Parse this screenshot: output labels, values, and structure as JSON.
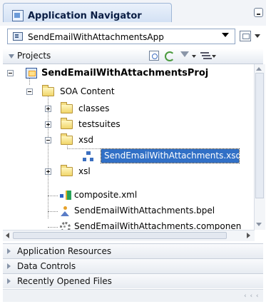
{
  "window": {
    "title": "Application Navigator",
    "title_icon": "application-navigator-icon",
    "minimize_icon": "minimize-icon"
  },
  "app_selector": {
    "value": "SendEmailWithAttachmentsApp",
    "icon": "application-icon"
  },
  "projects_panel": {
    "title": "Projects",
    "toolbar_icons": [
      "refresh-icon",
      "sync-icon",
      "filter-icon",
      "sort-icon"
    ]
  },
  "tree": {
    "project": {
      "label": "SendEmailWithAttachmentsProj",
      "icon": "project-icon"
    },
    "soa_content": {
      "label": "SOA Content",
      "icon": "folder-icon"
    },
    "classes": {
      "label": "classes",
      "icon": "folder-icon"
    },
    "testsuites": {
      "label": "testsuites",
      "icon": "folder-icon"
    },
    "xsd": {
      "label": "xsd",
      "icon": "folder-icon"
    },
    "xsd_file": {
      "label": "SendEmailWithAttachments.xsd",
      "icon": "xsd-schema-icon",
      "selected": true
    },
    "xsl": {
      "label": "xsl",
      "icon": "folder-icon"
    },
    "composite": {
      "label": "composite.xml",
      "icon": "composite-icon"
    },
    "bpel": {
      "label": "SendEmailWithAttachments.bpel",
      "icon": "bpel-process-icon"
    },
    "componentType": {
      "label": "SendEmailWithAttachments.componen",
      "icon": "component-type-icon"
    }
  },
  "accordion": [
    {
      "label": "Application Resources"
    },
    {
      "label": "Data Controls"
    },
    {
      "label": "Recently Opened Files"
    }
  ],
  "colors": {
    "selection": "#3170c6",
    "tab_border": "#9fb6d6",
    "folder_fill": "#f1d66a"
  }
}
